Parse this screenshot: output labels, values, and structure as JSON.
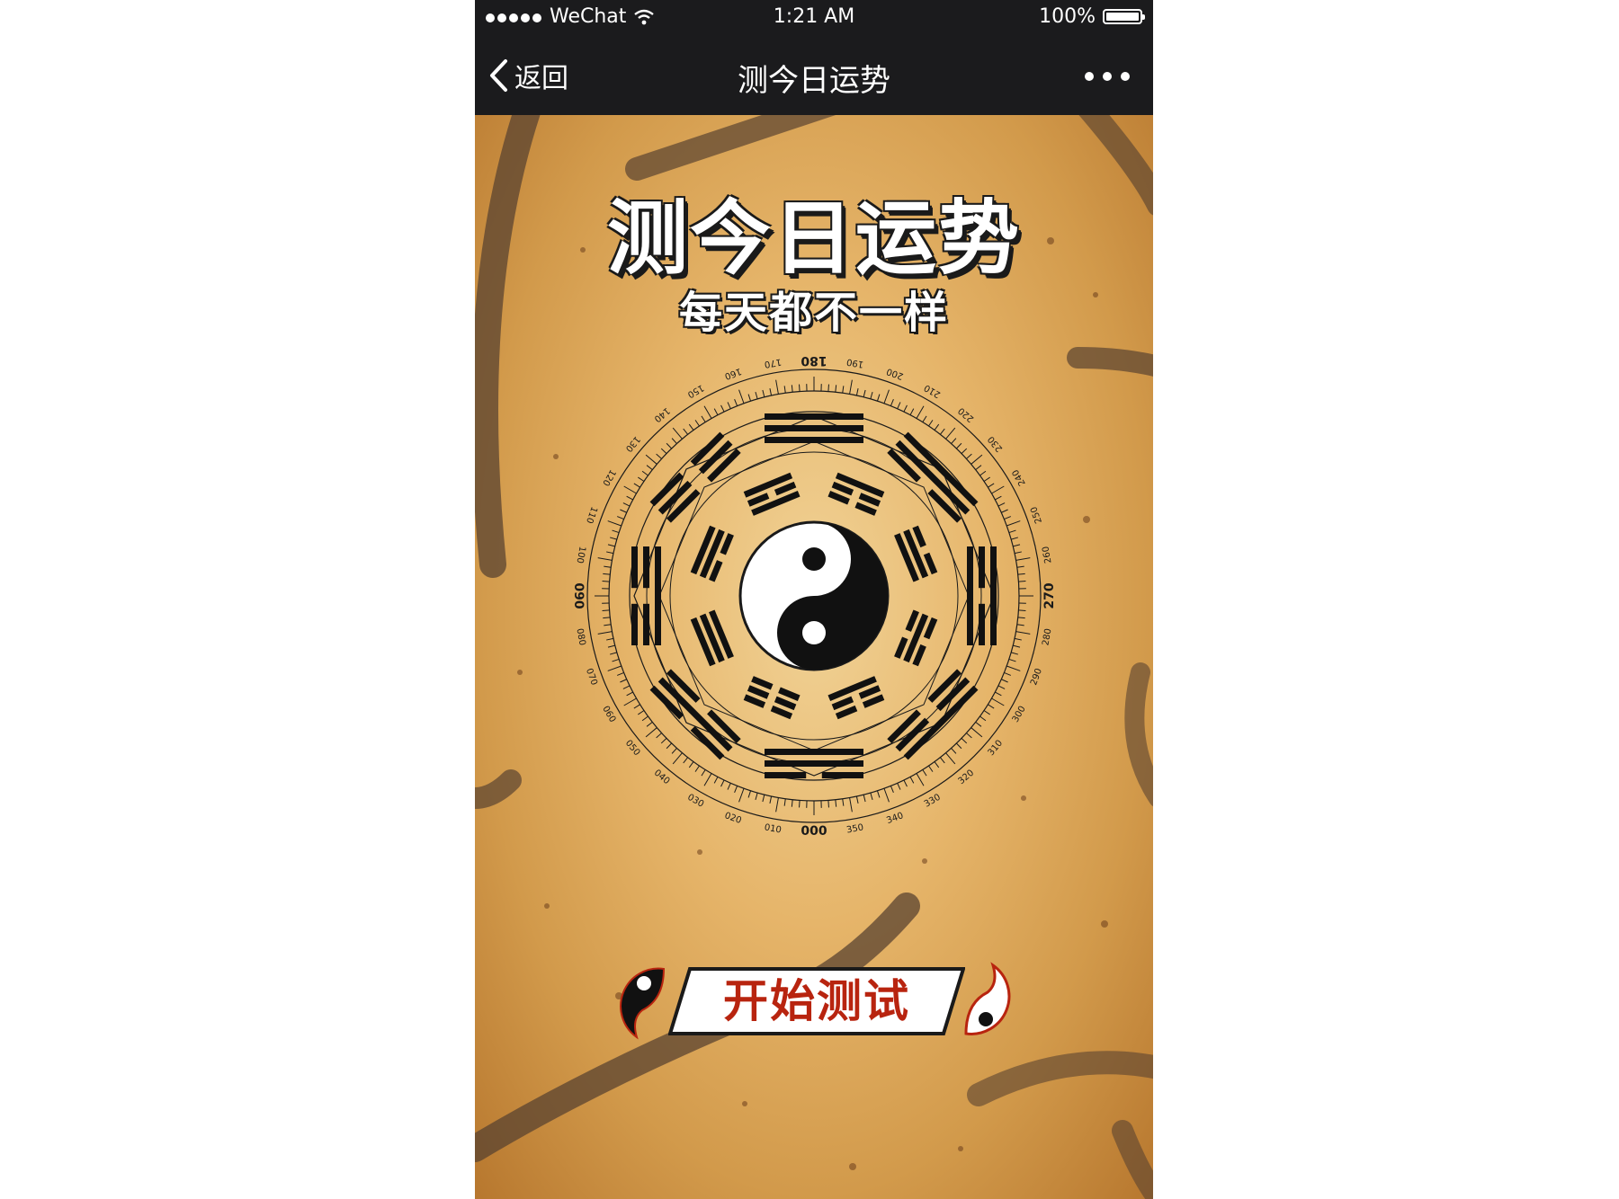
{
  "status_bar": {
    "carrier": "WeChat",
    "time": "1:21 AM",
    "battery": "100%"
  },
  "nav": {
    "back_label": "返回",
    "title": "测今日运势"
  },
  "hero": {
    "title": "测今日运势",
    "subtitle": "每天都不一样"
  },
  "compass": {
    "degree_labels": [
      "000",
      "010",
      "020",
      "030",
      "040",
      "050",
      "060",
      "070",
      "080",
      "090",
      "100",
      "110",
      "120",
      "130",
      "140",
      "150",
      "160",
      "170",
      "180",
      "190",
      "200",
      "210",
      "220",
      "230",
      "240",
      "250",
      "260",
      "270",
      "280",
      "290",
      "300",
      "310",
      "320",
      "330",
      "340",
      "350"
    ]
  },
  "start": {
    "label": "开始测试"
  },
  "colors": {
    "bar_dark": "#1b1b1d",
    "parchment": "#e6b56a",
    "button_text": "#b8240f"
  }
}
